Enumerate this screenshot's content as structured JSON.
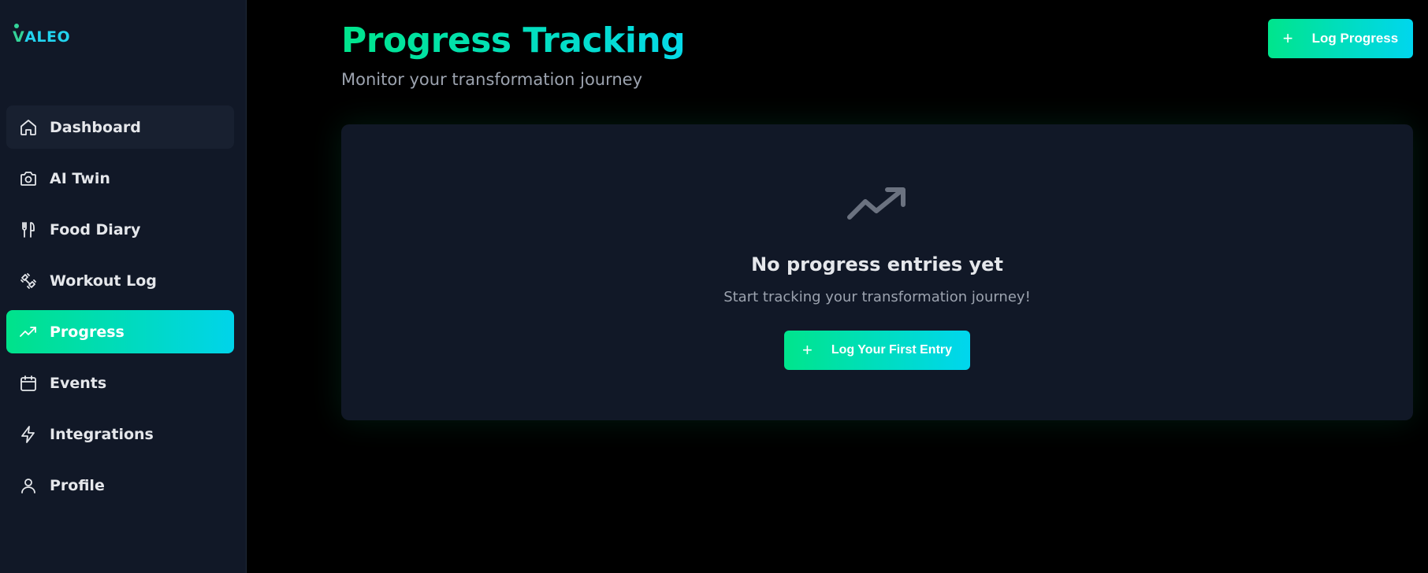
{
  "brand": {
    "logo_initial": "V",
    "logo_rest": "ALEO"
  },
  "sidebar": {
    "items": [
      {
        "label": "Dashboard",
        "icon": "home-icon"
      },
      {
        "label": "AI Twin",
        "icon": "camera-icon"
      },
      {
        "label": "Food Diary",
        "icon": "utensils-icon"
      },
      {
        "label": "Workout Log",
        "icon": "dumbbell-icon"
      },
      {
        "label": "Progress",
        "icon": "trending-up-icon",
        "active": true
      },
      {
        "label": "Events",
        "icon": "calendar-icon"
      },
      {
        "label": "Integrations",
        "icon": "zap-icon"
      },
      {
        "label": "Profile",
        "icon": "user-icon"
      }
    ]
  },
  "header": {
    "title": "Progress Tracking",
    "subtitle": "Monitor your transformation journey",
    "log_button_label": "Log Progress",
    "log_button_icon": "plus-icon"
  },
  "empty_state": {
    "icon": "trending-up-icon",
    "title": "No progress entries yet",
    "subtitle": "Start tracking your transformation journey!",
    "button_label": "Log Your First Entry",
    "button_icon": "plus-icon"
  },
  "colors": {
    "accent_start": "#00e58c",
    "accent_end": "#00d6ee",
    "sidebar_bg": "#111827",
    "page_bg": "#000000",
    "card_bg": "#111827"
  }
}
